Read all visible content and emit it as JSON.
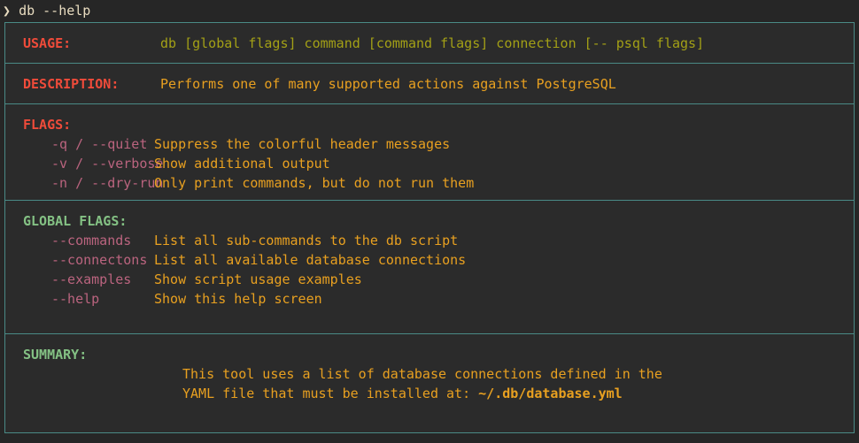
{
  "terminal": {
    "prompt_symbol": "❯",
    "command": "db --help",
    "background": "#262626",
    "border_color": "#4a8a86"
  },
  "colors": {
    "heading_red": "#ef4b3a",
    "heading_green": "#84c184",
    "usage_value_olive": "#a3a016",
    "description_amber": "#e8a020",
    "flag_pink": "#bb647f",
    "prompt_cream": "#e8dcc0"
  },
  "help": {
    "usage": {
      "label": "USAGE:",
      "value": "db [global flags] command [command flags] connection [-- psql flags]"
    },
    "description": {
      "label": "DESCRIPTION:",
      "value": "Performs one of many supported actions against PostgreSQL"
    },
    "flags": {
      "label": "FLAGS:",
      "items": [
        {
          "name": "-q / --quiet",
          "description": "Suppress the colorful header messages"
        },
        {
          "name": "-v / --verbose",
          "description": "Show additional output"
        },
        {
          "name": "-n / --dry-run",
          "description": "Only print commands, but do not run them"
        }
      ]
    },
    "global_flags": {
      "label": "GLOBAL FLAGS:",
      "items": [
        {
          "name": "--commands",
          "description": "List all sub-commands to the db script"
        },
        {
          "name": "--connectons",
          "description": "List all available database connections"
        },
        {
          "name": "--examples",
          "description": "Show script usage examples"
        },
        {
          "name": "--help",
          "description": "Show this help screen"
        }
      ]
    },
    "summary": {
      "label": "SUMMARY:",
      "line1": "This tool uses a list of database connections defined in the",
      "line2_prefix": "YAML file that must be installed at: ",
      "line2_path": "~/.db/database.yml"
    }
  }
}
